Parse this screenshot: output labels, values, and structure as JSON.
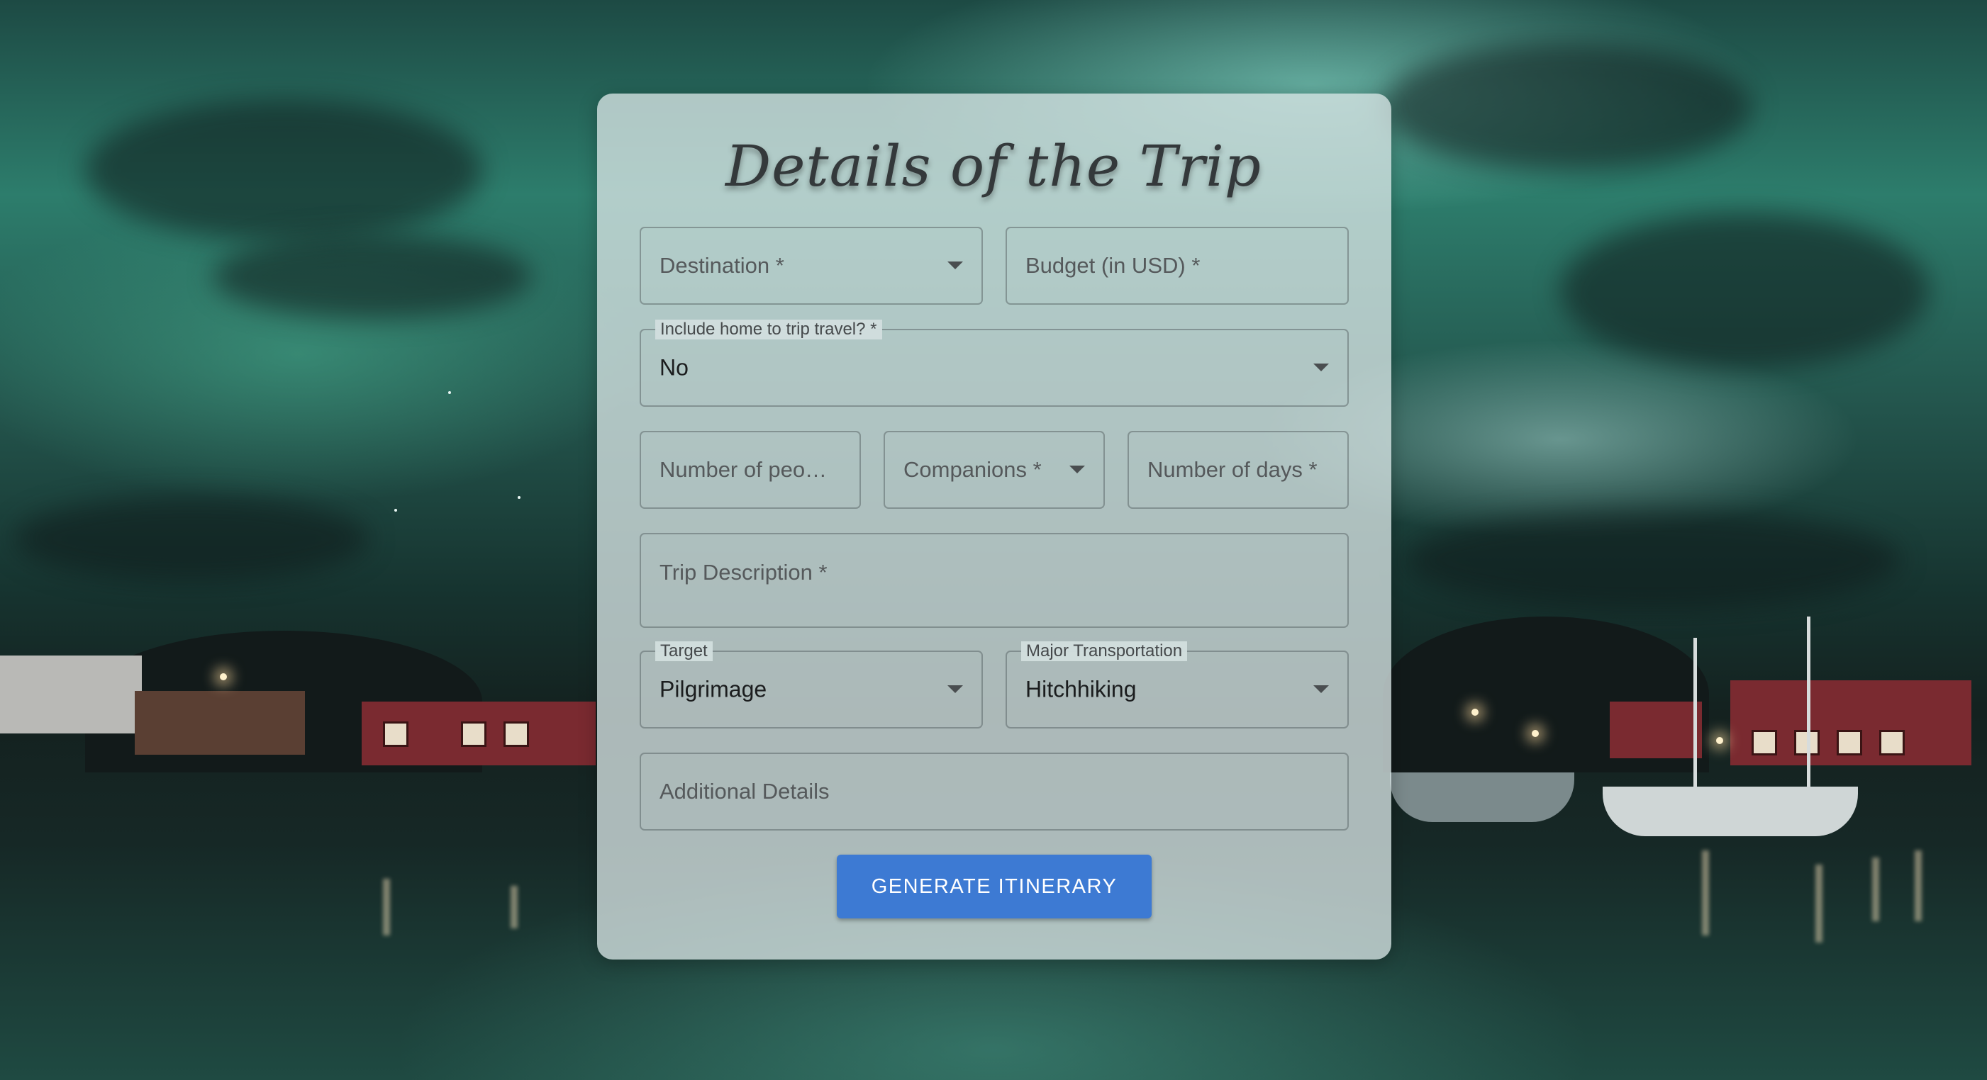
{
  "title": "Details of the Trip",
  "form": {
    "destination": {
      "placeholder": "Destination",
      "required": "*"
    },
    "budget": {
      "placeholder": "Budget (in USD)",
      "required": "*"
    },
    "home_travel": {
      "label": "Include home to trip travel?",
      "required": "*",
      "value": "No"
    },
    "num_people": {
      "placeholder": "Number of peo…"
    },
    "companions": {
      "placeholder": "Companions",
      "required": "*"
    },
    "num_days": {
      "placeholder": "Number of days",
      "required": "*"
    },
    "description": {
      "placeholder": "Trip Description",
      "required": "*"
    },
    "target": {
      "label": "Target",
      "value": "Pilgrimage"
    },
    "transportation": {
      "label": "Major Transportation",
      "value": "Hitchhiking"
    },
    "additional": {
      "placeholder": "Additional Details"
    }
  },
  "button": {
    "label": "GENERATE ITINERARY"
  },
  "colors": {
    "button": "#3d7ad3",
    "card": "#d7e4e4",
    "title": "#34393b"
  },
  "icons": {
    "dropdown": "caret-down-icon"
  }
}
